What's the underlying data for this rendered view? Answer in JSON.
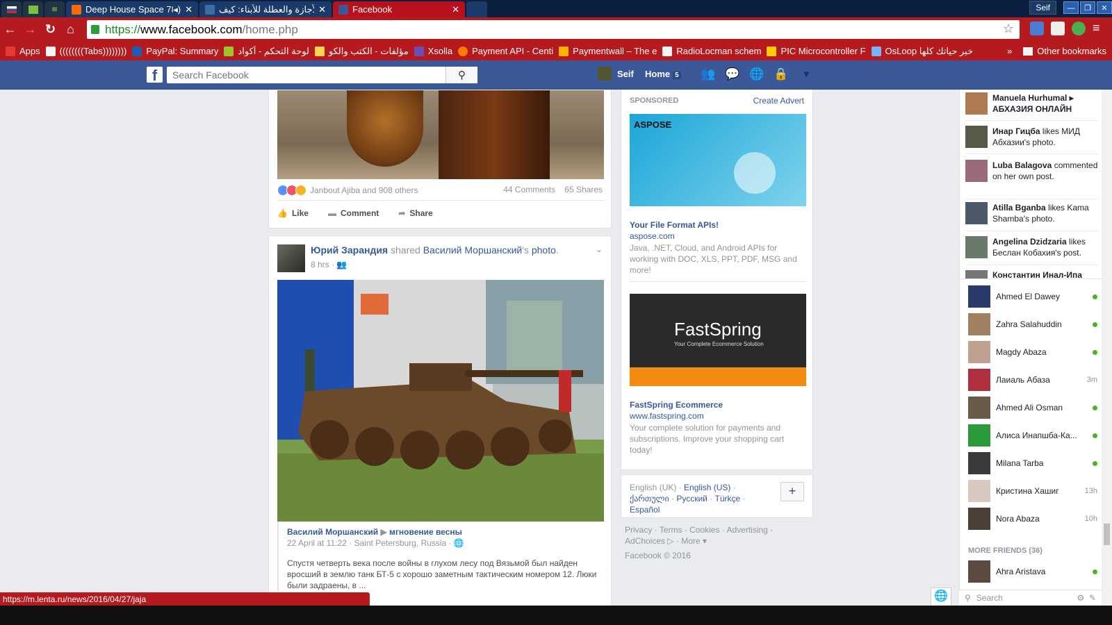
{
  "browser": {
    "tabs": [
      {
        "label": "Deep House Space 78",
        "icon": "soundcloud-icon"
      },
      {
        "label": "الأجازة والعطلة للأبناء: كيف",
        "icon": "arabic-site-icon"
      },
      {
        "label": "Facebook",
        "icon": "facebook-icon",
        "active": true
      }
    ],
    "profile_name": "Seif",
    "url": {
      "scheme": "https://",
      "host": "www.facebook.com",
      "path": "/home.php"
    },
    "bookmarks": [
      {
        "label": "Apps",
        "icon": "apps-grid-icon",
        "color": "#e53935"
      },
      {
        "label": "((((((((Tabs))))))))",
        "icon": "folder-icon",
        "color": "#f4f4f4"
      },
      {
        "label": "PayPal: Summary",
        "icon": "paypal-icon",
        "color": "#1e5db5"
      },
      {
        "label": "لوحة التحكم - أكواد",
        "icon": "akwad-icon",
        "color": "#9ec82a"
      },
      {
        "label": "مؤلفات - الكتب والكو",
        "icon": "megaphone-icon",
        "color": "#ffd54f"
      },
      {
        "label": "Xsolla",
        "icon": "xsolla-icon",
        "color": "#6a4fb8"
      },
      {
        "label": "Payment API - Centi",
        "icon": "payment-icon",
        "color": "#ff7a00"
      },
      {
        "label": "Paymentwall – The e",
        "icon": "paymentwall-icon",
        "color": "#ffb300"
      },
      {
        "label": "RadioLocman schem",
        "icon": "rl-icon",
        "color": "#f5f5f5"
      },
      {
        "label": "PIC Microcontroller F",
        "icon": "pic-icon",
        "color": "#ffcc00"
      },
      {
        "label": "OsLoop خبر حياتك كلها",
        "icon": "osloop-icon",
        "color": "#7bb0ff"
      }
    ],
    "other_bookmarks": "Other bookmarks",
    "status_url": "https://m.lenta.ru/news/2016/04/27/jaja"
  },
  "fb": {
    "search_placeholder": "Search Facebook",
    "user": "Seif",
    "home": "Home",
    "home_count": "5"
  },
  "post1": {
    "reactions_text": "Janbout Ajiba and 908 others",
    "comments": "44 Comments",
    "shares": "65 Shares",
    "like": "Like",
    "comment": "Comment",
    "share": "Share"
  },
  "post2": {
    "author": "Юрий Зарандия",
    "shared": "shared",
    "source": "Василий Моршанский",
    "possessive": "'s",
    "object": "photo",
    "time": "8 hrs",
    "cap_author": "Василий Моршанский",
    "cap_target": "мгновение весны",
    "cap_meta": "22 April at 11:22 · Saint Petersburg, Russia ·",
    "cap_text": "Спустя четверть века после войны в глухом лесу под Вязьмой был найден вросший в землю танк БТ-5 с хорошо заметным тактическим номером 12. Люки были задраены, в ..."
  },
  "sponsored": {
    "header": "SPONSORED",
    "create": "Create Advert",
    "ads": [
      {
        "brand": "ASPOSE",
        "title": "Your File Format APIs!",
        "url": "aspose.com",
        "desc": "Java, .NET, Cloud, and Android APIs for working with DOC, XLS, PPT, PDF, MSG and more!"
      },
      {
        "brand": "FastSpring",
        "tagline": "Your Complete Ecommerce Solution",
        "title": "FastSpring Ecommerce",
        "url": "www.fastspring.com",
        "desc": "Your complete solution for payments and subscriptions. Improve your shopping cart today!"
      }
    ]
  },
  "languages": {
    "current": "English (UK) ·",
    "links": [
      "English (US)",
      "ქართული",
      "Русский",
      "Türkçe",
      "Español"
    ]
  },
  "footer": {
    "line1": "Privacy · Terms · Cookies · Advertising ·",
    "line2": "AdChoices ▷ · More ▾",
    "copyright": "Facebook © 2016"
  },
  "ticker": [
    {
      "name": "Manuela Hurhumal",
      "rest": "▸ АБХАЗИЯ ОНЛАЙН"
    },
    {
      "name": "Инар Гицба",
      "rest": "likes МИД Абхазии's photo."
    },
    {
      "name": "Luba Balagova",
      "rest": "commented on her own post."
    },
    {
      "name": "Atilla Bganba",
      "rest": "likes Kama Shamba's photo."
    },
    {
      "name": "Angelina Dzidzaria",
      "rest": "likes Беслан Кобахия's post."
    },
    {
      "name": "Константин Инал-Ипа",
      "rest": ""
    }
  ],
  "friends": [
    {
      "name": "Ahmed El Dawey",
      "status": "online"
    },
    {
      "name": "Zahra Salahuddin",
      "status": "online"
    },
    {
      "name": "Magdy Abaza",
      "status": "online"
    },
    {
      "name": "Лаиаль Абаза",
      "status": "3m"
    },
    {
      "name": "Ahmed Ali Osman",
      "status": "online"
    },
    {
      "name": "Алиса Инапшба-Ка...",
      "status": "online"
    },
    {
      "name": "Milana Tarba",
      "status": "online"
    },
    {
      "name": "Кристина Хашиг",
      "status": "13h"
    },
    {
      "name": "Nora Abaza",
      "status": "10h"
    }
  ],
  "more_friends": "MORE FRIENDS (36)",
  "more_friend_list": [
    {
      "name": "Ahra Aristava",
      "status": "online"
    }
  ],
  "chat_search": "Search"
}
